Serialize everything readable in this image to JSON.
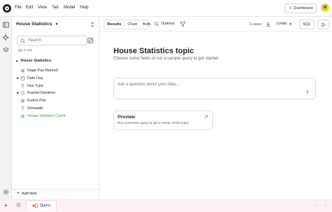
{
  "menubar": {
    "items": [
      "File",
      "Edit",
      "View",
      "Tab",
      "Model",
      "Help"
    ],
    "dashboard_label": "Dashboard",
    "avatar_initial": "M"
  },
  "sidebar": {
    "explore_title": "House Statistics",
    "search_placeholder": "Search",
    "in_use_label": "In use",
    "view_name": "House Statistics",
    "fields": [
      {
        "label": "Dage Paa Marked",
        "kind": "dimension",
        "type": "number",
        "expandable": false
      },
      {
        "label": "Date Day",
        "kind": "dimension",
        "type": "date",
        "expandable": true
      },
      {
        "label": "Hus Type",
        "kind": "dimension",
        "type": "string",
        "expandable": false
      },
      {
        "label": "Kvartal Datetime",
        "kind": "dimension",
        "type": "date",
        "expandable": true
      },
      {
        "label": "Kvdrm Pris",
        "kind": "dimension",
        "type": "number",
        "expandable": false
      },
      {
        "label": "Omraade",
        "kind": "dimension",
        "type": "string",
        "expandable": false
      },
      {
        "label": "House Statistics Count",
        "kind": "measure",
        "type": "number",
        "expandable": false
      }
    ],
    "add_field_label": "Add field"
  },
  "toolbar": {
    "tabs": [
      "Results",
      "Chart",
      "Both"
    ],
    "options_label": "Options",
    "cases_label": "0 cases",
    "limits_label": "Limits",
    "sql_label": "SQL"
  },
  "main": {
    "title": "House Statistics topic",
    "subtitle": "Choose some fields or run a sample query to get started",
    "ask_placeholder": "Ask a question about your data...",
    "preview_title": "Preview",
    "preview_desc": "Run a preview query to get a sense of this topic."
  },
  "bottombar": {
    "query_tab_label": "Query"
  },
  "colors": {
    "measure": "#2b9a46",
    "bottombar_bg": "#fdf1f7",
    "avatar_bg": "#e7d04a"
  }
}
